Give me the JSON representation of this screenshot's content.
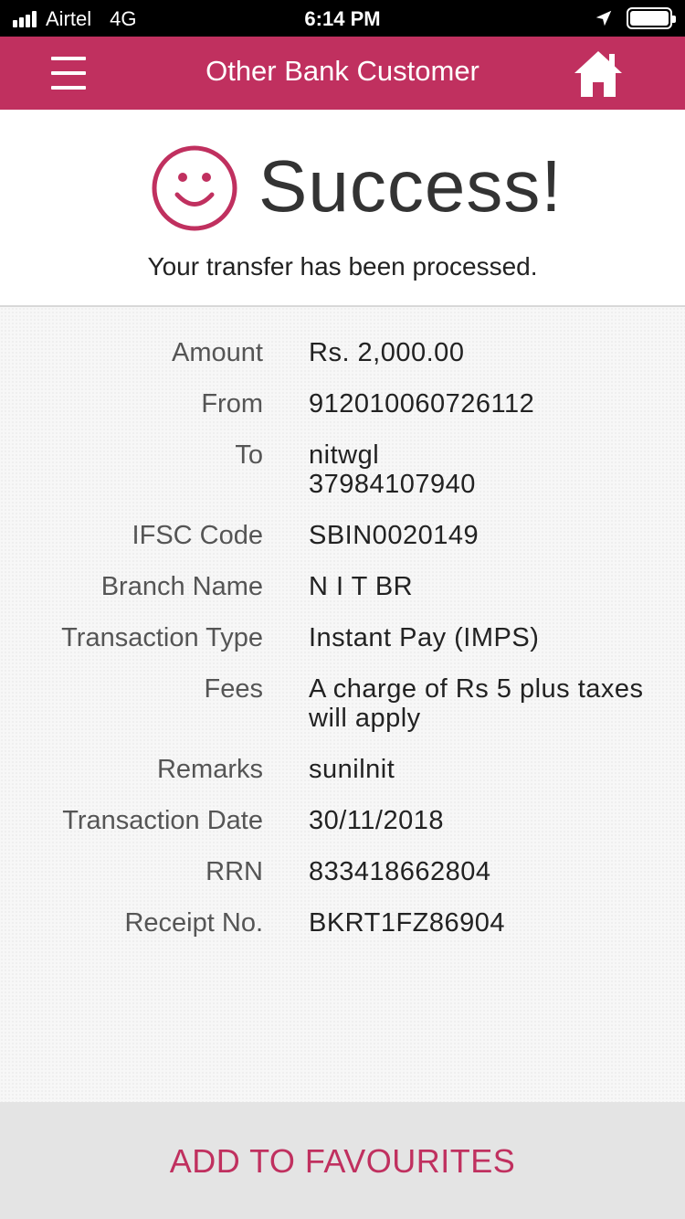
{
  "status_bar": {
    "carrier": "Airtel",
    "network": "4G",
    "time": "6:14 PM"
  },
  "nav": {
    "title": "Other Bank Customer",
    "menu_icon": "hamburger-menu-icon",
    "home_icon": "home-icon"
  },
  "result": {
    "icon": "smiley-icon",
    "title": "Success!",
    "message": "Your transfer has been processed."
  },
  "details": [
    {
      "label": "Amount",
      "value": "Rs. 2,000.00"
    },
    {
      "label": "From",
      "value": "912010060726112"
    },
    {
      "label": "To",
      "value": "nitwgl",
      "value2": "37984107940"
    },
    {
      "label": "IFSC Code",
      "value": "SBIN0020149"
    },
    {
      "label": "Branch Name",
      "value": "N I T BR"
    },
    {
      "label": "Transaction Type",
      "value": "Instant Pay (IMPS)"
    },
    {
      "label": "Fees",
      "value": "A charge of Rs 5 plus taxes",
      "value2": "will apply"
    },
    {
      "label": "Remarks",
      "value": "sunilnit"
    },
    {
      "label": "Transaction Date",
      "value": "30/11/2018"
    },
    {
      "label": "RRN",
      "value": "833418662804"
    },
    {
      "label": "Receipt No.",
      "value": "BKRT1FZ86904"
    }
  ],
  "footer": {
    "button_label": "ADD TO FAVOURITES"
  },
  "colors": {
    "brand": "#c0305f",
    "footer_bg": "#e4e4e4"
  }
}
